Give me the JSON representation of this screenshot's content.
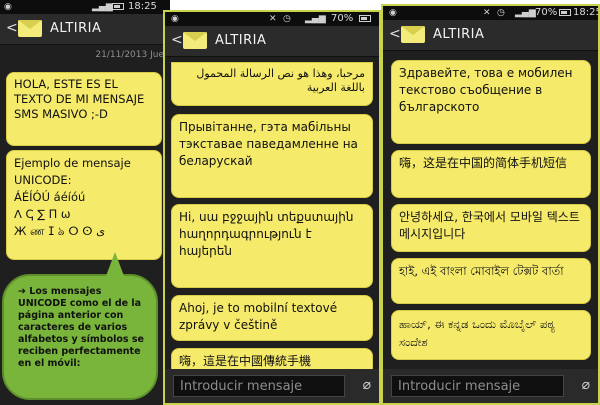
{
  "phones": {
    "left": {
      "status": {
        "time": "18:25",
        "battery": "70%"
      },
      "title": "ALTIRIA",
      "date": "21/11/2013 Jue",
      "bubble1": "HOLA, ESTE ES EL TEXTO DE MI MENSAJE SMS MASIVO ;-D",
      "bubble2": "Ejemplo de mensaje\nUNICODE:\nÁÉÍÓÚ áéíóú\nᐱ ↅ ∑ Π ω\nЖ ண ⵊ ঌ ⵔ ⵙ ی",
      "callout": "Los mensajes UNICODE como el de la página anterior con caracteres de varios alfabetos y símbolos se reciben perfectamente en el móvil:",
      "callout_arrow": "➔"
    },
    "middle": {
      "status": {
        "battery": "70%"
      },
      "title": "ALTIRIA",
      "bubble_ar": "مرحبا، وهذا هو نص الرسالة المحمول باللغة العربية",
      "bubble_be": "Прывітанне, гэта мабільны тэкставае паведамленне на беларускай",
      "bubble_hy": "Hi, սա բջջային տեքստային հաղորդագրություն է հայերեն",
      "bubble_cs": "Ahoj, je to mobilní textové zprávy v češtině",
      "bubble_zh_tw": "嗨，這是在中國傳統手機",
      "input_placeholder": "Introducir mensaje"
    },
    "right": {
      "status": {
        "time": "18:25",
        "battery": "70%"
      },
      "title": "ALTIRIA",
      "bubble_bg": "Здравейте, това е мобилен текстово съобщение в българското",
      "bubble_zh_cn": "嗨，这是在中国的简体手机短信",
      "bubble_ko": "안녕하세요, 한국에서 모바일 텍스트 메시지입니다",
      "bubble_bn": "হাই, এই বাংলা মোবাইল টেক্সট বার্তা",
      "bubble_kn": "ಹಾಯ್, ಈ ಕನ್ನಡ ಒಂದು ಮೊಬೈಲ್ ಪಠ್ಯ ಸಂದೇಶ",
      "input_placeholder": "Introducir mensaje"
    }
  }
}
